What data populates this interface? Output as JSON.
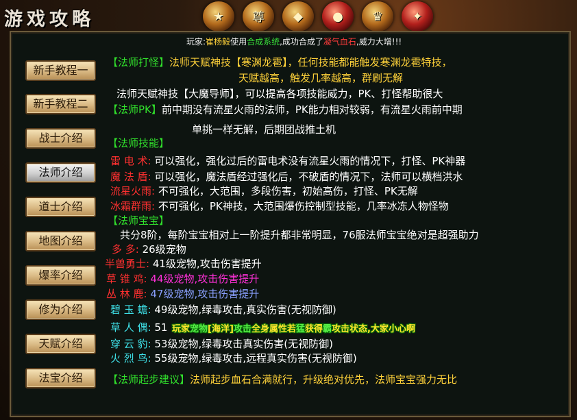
{
  "header": {
    "title": "游戏攻略"
  },
  "top_icons": [
    "medal-icon",
    "chest-icon",
    "treasure-icon",
    "potion-bag-icon",
    "crest-icon",
    "jewel-icon"
  ],
  "notice": {
    "prefix": "玩家:",
    "player": "崔杨毅",
    "mid1": "使用",
    "system": "合成系统",
    "mid2": ",成功合成了",
    "item": "凝气血石",
    "suffix": ",威力大增!!!"
  },
  "nav": [
    {
      "label": "新手教程一"
    },
    {
      "label": "新手教程二"
    },
    {
      "label": "战士介绍"
    },
    {
      "label": "法师介绍"
    },
    {
      "label": "道士介绍"
    },
    {
      "label": "地图介绍"
    },
    {
      "label": "爆率介绍"
    },
    {
      "label": "修为介绍"
    },
    {
      "label": "天赋介绍"
    },
    {
      "label": "法宝介绍"
    }
  ],
  "content": {
    "l1_tag": "【法师打怪】",
    "l1_text": "法师天赋神技【寒渊龙雹】，任何技能都能触发寒渊龙雹特技，",
    "l2": "天赋越高，触发几率越高，群刷无解",
    "l3": "法师天赋神技【大魔导师】，可以提高各项技能威力，PK、打怪帮助很大",
    "l4_tag": "【法师PK】",
    "l4_text": "前中期没有流星火雨的法师，PK能力相对较弱，有流星火雨前中期",
    "l5": "单挑一样无解，后期团战推土机",
    "skills_tag": "【法师技能】",
    "skills": [
      {
        "name": "雷 电 术:",
        "desc": "可以强化，强化过后的雷电术没有流星火雨的情况下，打怪、PK神器"
      },
      {
        "name": "魔 法 盾:",
        "desc": "可以强化，魔法盾经过强化后，不破盾的情况下，法师可以横档洪水"
      },
      {
        "name": "流星火雨:",
        "desc": "不可强化，大范围，多段伤害，初始高伤，打怪、PK无解"
      },
      {
        "name": "冰霜群雨:",
        "desc": "不可强化，PK神技，大范围爆伤控制型技能，几率冰冻人物怪物"
      }
    ],
    "treasure_tag": "【法师宝宝】",
    "treasure_intro": "共分8阶，每阶宝宝相对上一阶提升都非常明显，76服法师宝宝绝对是超强助力",
    "pets": [
      {
        "name": "多    多:",
        "desc": "26级宠物"
      },
      {
        "name": "半兽勇士:",
        "desc": "41级宠物,攻击伤害提升"
      },
      {
        "name": "草 锥 鸡:",
        "desc": "44级宠物,攻击伤害提升"
      },
      {
        "name": "丛 林 鹿:",
        "desc": "47级宠物,攻击伤害提升"
      },
      {
        "name": "碧 玉 蟾:",
        "desc": "49级宠物,绿毒攻击,真实伤害(无视防御)"
      },
      {
        "name": "草 人 偶:",
        "desc": "51"
      },
      {
        "name": "穿 云 豹:",
        "desc": "53级宠物,绿毒攻击真实伤害(无视防御)"
      },
      {
        "name": "火 烈 鸟:",
        "desc": "55级宠物,绿毒攻击,远程真实伤害(无视防御)"
      }
    ],
    "advice_tag": "【法师起步建议】",
    "advice_text": "法师起步血石合满就行，升级绝对优先，法师宝宝强力无比"
  },
  "overlay": {
    "a": "玩家",
    "b": "宠物",
    "c": "[海洋]",
    "d": "攻击",
    "e": "全身属性若",
    "f": "猛",
    "g": "获得",
    "h": "霸",
    "i": "攻击状态,大家小心啊"
  }
}
